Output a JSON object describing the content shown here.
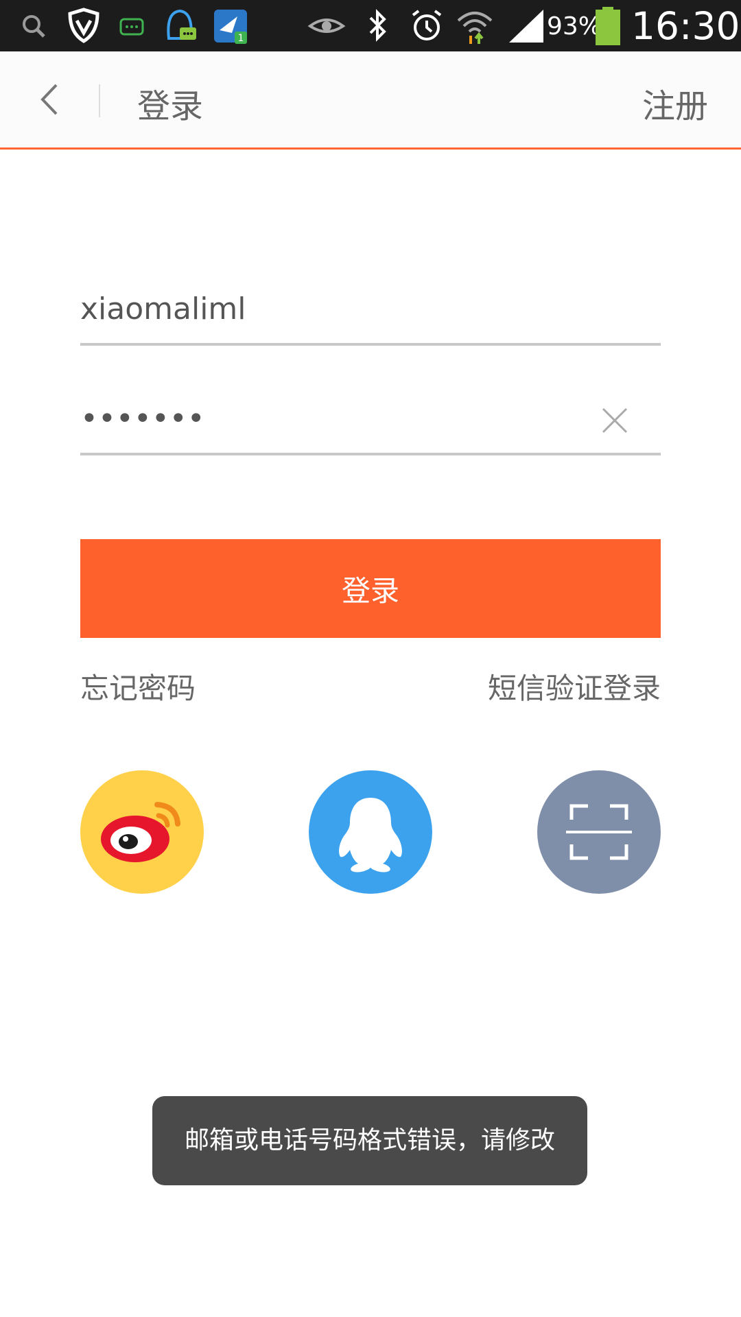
{
  "status_bar": {
    "battery_percent": "93%",
    "time": "16:30",
    "icons": [
      "search-icon",
      "shield-icon",
      "chat-icon",
      "qq-notify-icon",
      "mail-app-icon",
      "eye-icon",
      "bluetooth-icon",
      "alarm-icon",
      "wifi-icon",
      "signal-icon",
      "battery-icon"
    ],
    "badge_count": "1"
  },
  "header": {
    "title": "登录",
    "register_label": "注册"
  },
  "form": {
    "username_value": "xiaomaliml",
    "password_value": "•••••••"
  },
  "actions": {
    "login_label": "登录",
    "forgot_label": "忘记密码",
    "sms_login_label": "短信验证登录"
  },
  "toast": {
    "message": "邮箱或电话号码格式错误，请修改"
  },
  "colors": {
    "accent": "#ff612d",
    "weibo": "#ffd04a",
    "qq": "#3da2ee",
    "scan": "#7f8ea9",
    "toast_bg": "#4a4a4a"
  }
}
